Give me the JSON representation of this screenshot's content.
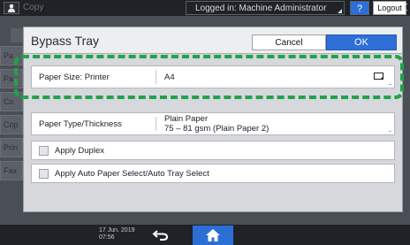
{
  "status_bar": {
    "app_label": "Copy",
    "login_status": "Logged in: Machine Administrator",
    "help_label": "?",
    "logout_label": "Logout"
  },
  "background": {
    "side_tabs": [
      "Pa",
      "Pa",
      "Co",
      "Cop",
      "Prin",
      "Fax"
    ]
  },
  "dialog": {
    "title": "Bypass Tray",
    "cancel_label": "Cancel",
    "ok_label": "OK",
    "paper_size": {
      "label": "Paper Size: Printer",
      "value": "A4",
      "more": "..."
    },
    "paper_type": {
      "label": "Paper Type/Thickness",
      "value_line1": "Plain Paper",
      "value_line2": "75 – 81 gsm (Plain Paper 2)",
      "more": "..."
    },
    "apply_duplex": {
      "label": "Apply Duplex",
      "checked": false
    },
    "apply_auto_select": {
      "label": "Apply Auto Paper Select/Auto Tray Select",
      "checked": false
    }
  },
  "bottom_bar": {
    "date": "17 Jun. 2019",
    "time": "07:56"
  },
  "colors": {
    "highlight": "#1fa34a",
    "primary": "#2e6fd8"
  }
}
